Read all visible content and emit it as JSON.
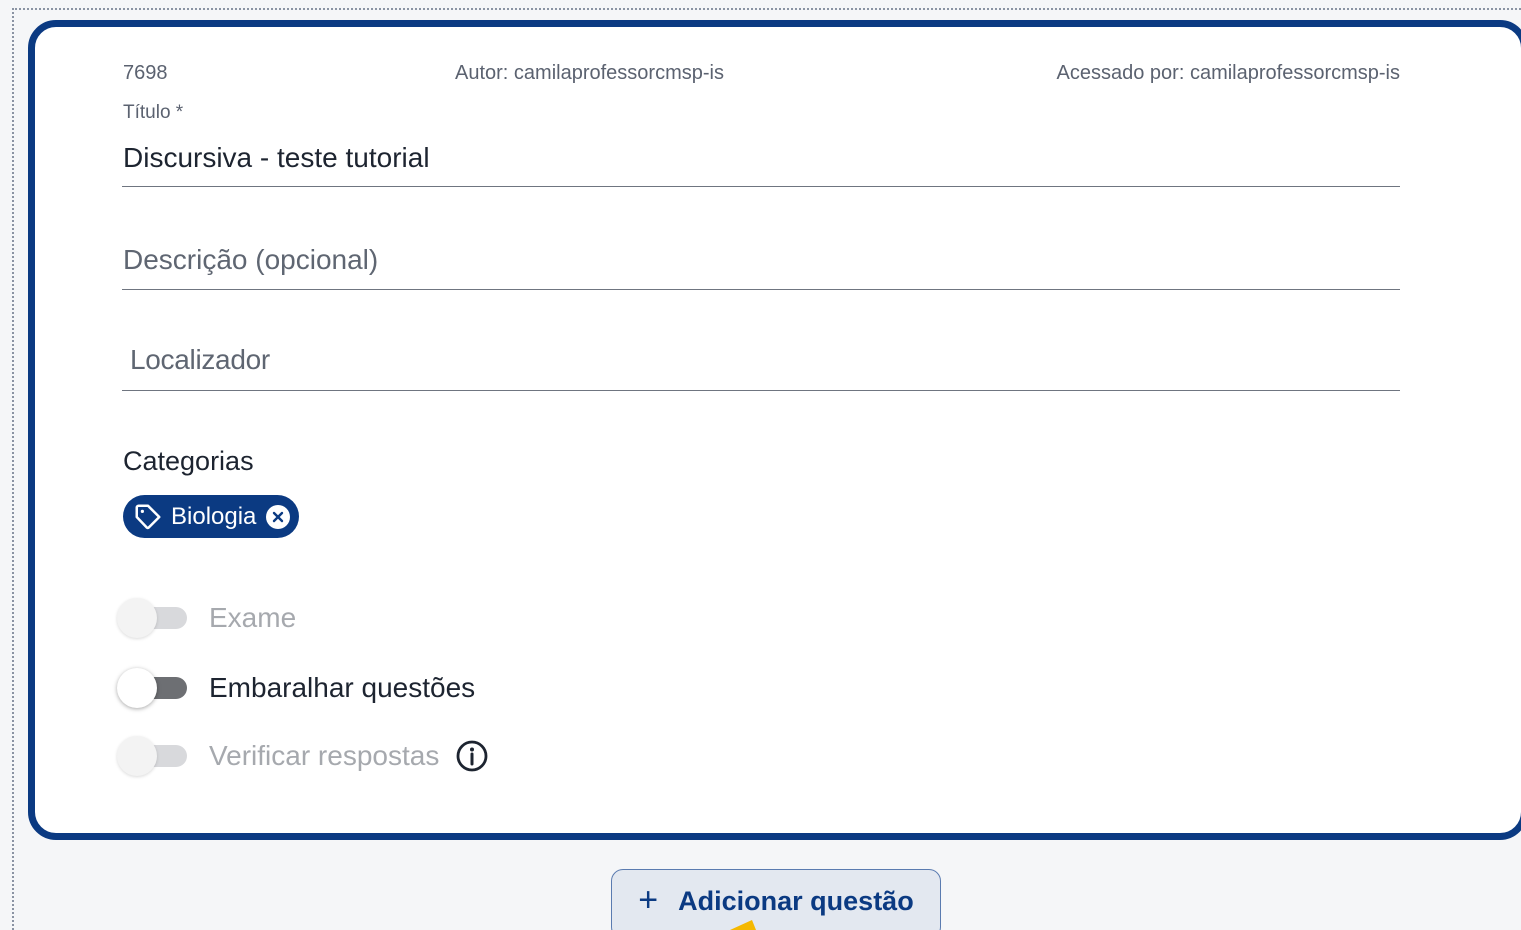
{
  "colors": {
    "accent": "#0b3a82",
    "chip_bg": "#0b3a82",
    "button_bg": "#e3e8f0"
  },
  "meta": {
    "id": "7698",
    "author": "Autor: camilaprofessorcmsp-is",
    "accessed_by": "Acessado por: camilaprofessorcmsp-is"
  },
  "form": {
    "title_label": "Título *",
    "title_value": "Discursiva - teste tutorial",
    "description_placeholder": "Descrição (opcional)",
    "locator_placeholder": "Localizador"
  },
  "categories": {
    "heading": "Categorias",
    "chips": [
      {
        "label": "Biologia",
        "icon": "tag-icon"
      }
    ]
  },
  "toggles": [
    {
      "label": "Exame",
      "on": false,
      "disabled": true
    },
    {
      "label": "Embaralhar questões",
      "on": false,
      "disabled": false
    },
    {
      "label": "Verificar respostas",
      "on": false,
      "disabled": true,
      "info_icon": "info-icon"
    }
  ],
  "actions": {
    "add_question_label": "Adicionar questão",
    "add_icon": "plus-icon"
  }
}
